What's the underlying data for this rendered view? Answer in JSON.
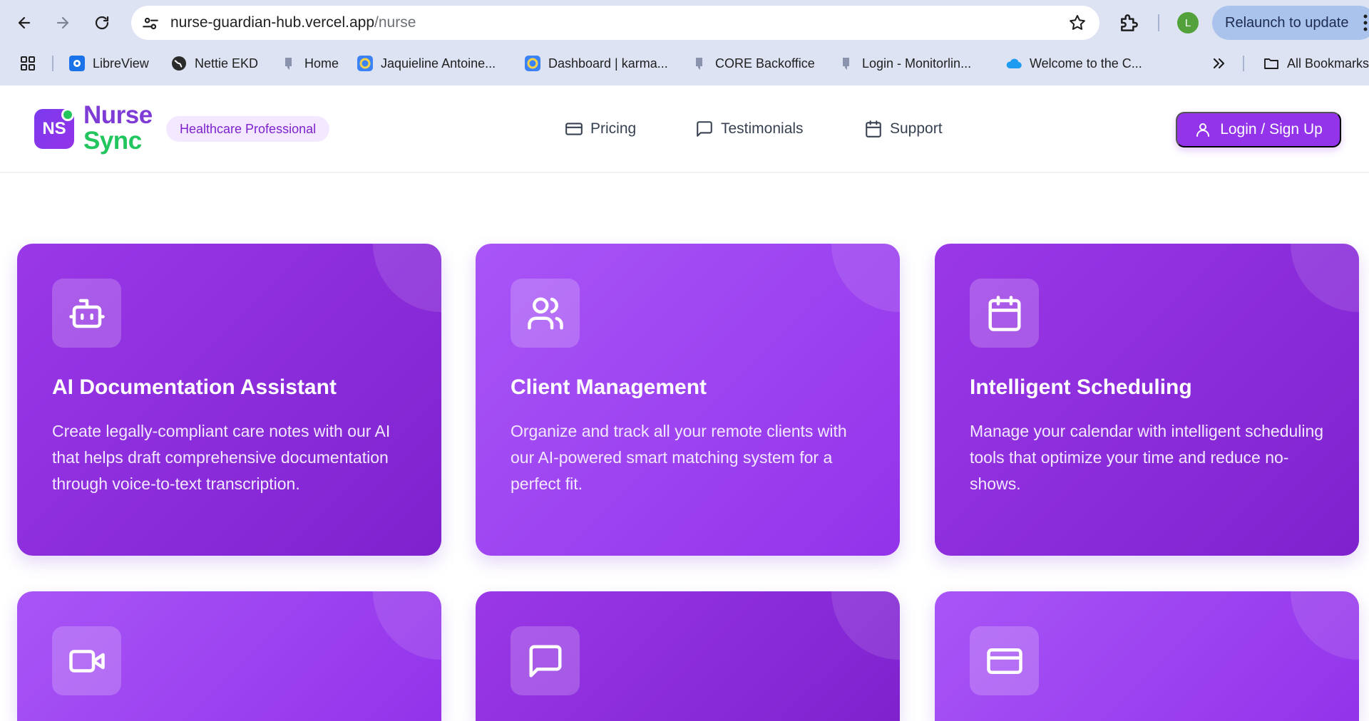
{
  "browser": {
    "url_host": "nurse-guardian-hub.vercel.app",
    "url_path": "/nurse",
    "profile_initial": "L",
    "relaunch_label": "Relaunch to update",
    "bookmarks": [
      {
        "label": "LibreView",
        "icon": "libreview-icon"
      },
      {
        "label": "Nettie EKD",
        "icon": "globe-icon"
      },
      {
        "label": "Home",
        "icon": "q-logo-icon"
      },
      {
        "label": "Jaquieline Antoine...",
        "icon": "ring-icon"
      },
      {
        "label": "Dashboard | karma...",
        "icon": "ring-icon"
      },
      {
        "label": "CORE Backoffice",
        "icon": "q-logo-icon"
      },
      {
        "label": "Login - Monitorlin...",
        "icon": "q-logo-icon"
      },
      {
        "label": "Welcome to the C...",
        "icon": "cloud-icon"
      }
    ],
    "all_bookmarks_label": "All Bookmarks"
  },
  "header": {
    "logo_mark": "NS",
    "logo_line1": "Nurse",
    "logo_line2": "Sync",
    "role_badge": "Healthcare Professional",
    "nav": [
      {
        "label": "Pricing",
        "icon": "credit-card-icon"
      },
      {
        "label": "Testimonials",
        "icon": "message-square-icon"
      },
      {
        "label": "Support",
        "icon": "calendar-icon"
      }
    ],
    "login_label": "Login / Sign Up"
  },
  "features": [
    {
      "title": "AI Documentation Assistant",
      "description": "Create legally-compliant care notes with our AI that helps draft comprehensive documentation through voice-to-text transcription.",
      "icon": "bot-icon"
    },
    {
      "title": "Client Management",
      "description": "Organize and track all your remote clients with our AI-powered smart matching system for a perfect fit.",
      "icon": "users-icon"
    },
    {
      "title": "Intelligent Scheduling",
      "description": "Manage your calendar with intelligent scheduling tools that optimize your time and reduce no-shows.",
      "icon": "calendar-icon"
    },
    {
      "title": "",
      "description": "",
      "icon": "video-icon"
    },
    {
      "title": "",
      "description": "",
      "icon": "message-square-icon"
    },
    {
      "title": "",
      "description": "",
      "icon": "credit-card-icon"
    }
  ],
  "colors": {
    "brand_purple": "#9333ea",
    "brand_green": "#22c55e",
    "card_dark": "#7e22ce",
    "card_light": "#a855f7",
    "chrome_bg": "#dde3f2"
  }
}
